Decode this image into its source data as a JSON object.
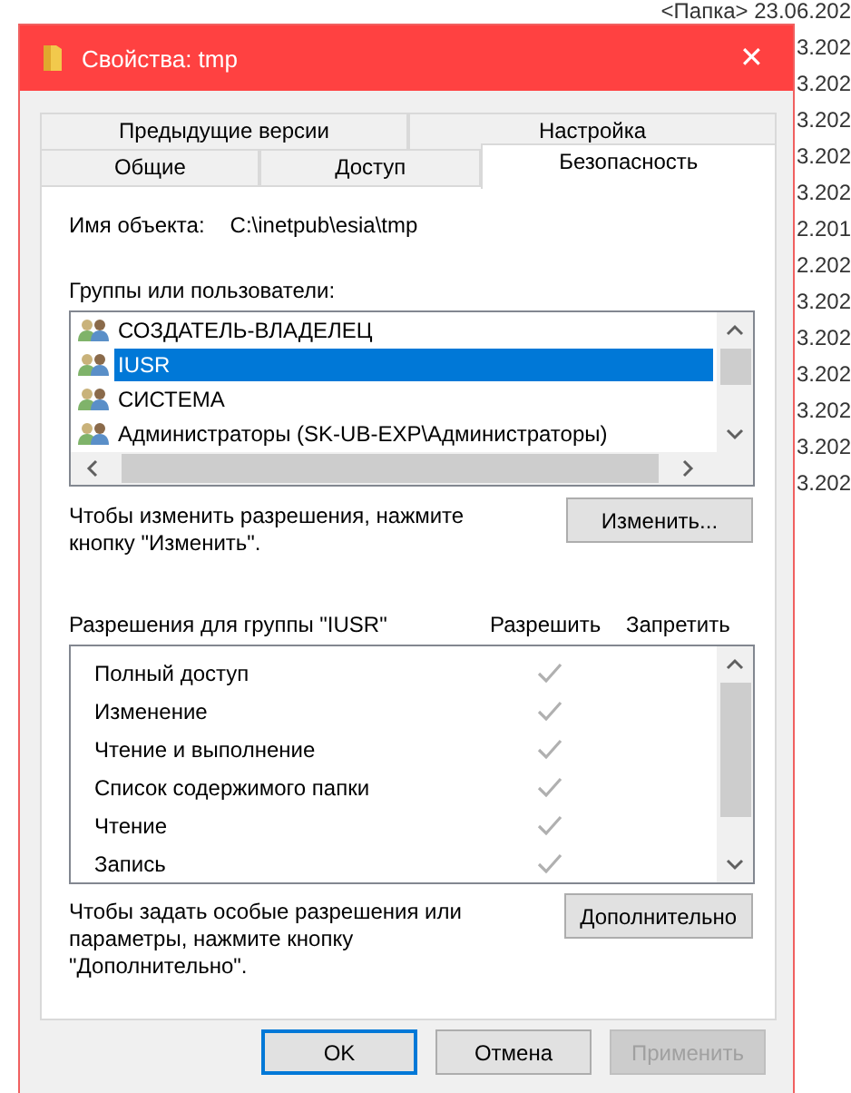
{
  "background_list": {
    "rows": [
      "<Папка>  23.06.202",
      "3.202",
      "3.202",
      "3.202",
      "3.202",
      "3.202",
      "2.201",
      "2.202",
      "3.202",
      "3.202",
      "3.202",
      "3.202",
      "3.202",
      "3.202"
    ]
  },
  "window": {
    "title": "Свойства: tmp",
    "close": "✕"
  },
  "tabs": [
    [
      {
        "label": "Предыдущие версии",
        "selected": false
      },
      {
        "label": "Настройка",
        "selected": false
      }
    ],
    [
      {
        "label": "Общие",
        "selected": false
      },
      {
        "label": "Доступ",
        "selected": false
      },
      {
        "label": "Безопасность",
        "selected": true
      }
    ]
  ],
  "object_name": {
    "label": "Имя объекта:",
    "value": "C:\\inetpub\\esia\\tmp"
  },
  "groups": {
    "label": "Группы или пользователи:",
    "items": [
      {
        "name": "СОЗДАТЕЛЬ-ВЛАДЕЛЕЦ",
        "selected": false
      },
      {
        "name": "IUSR",
        "selected": true
      },
      {
        "name": "СИСТЕМА",
        "selected": false
      },
      {
        "name": "Администраторы (SK-UB-EXP\\Администраторы)",
        "selected": false
      }
    ]
  },
  "change_hint": "Чтобы изменить разрешения, нажмите кнопку \"Изменить\".",
  "change_button": "Изменить...",
  "permissions": {
    "label": "Разрешения для группы \"IUSR\"",
    "allow_header": "Разрешить",
    "deny_header": "Запретить",
    "items": [
      {
        "name": "Полный доступ",
        "allow": true
      },
      {
        "name": "Изменение",
        "allow": true
      },
      {
        "name": "Чтение и выполнение",
        "allow": true
      },
      {
        "name": "Список содержимого папки",
        "allow": true
      },
      {
        "name": "Чтение",
        "allow": true
      },
      {
        "name": "Запись",
        "allow": true
      }
    ]
  },
  "advanced_hint": "Чтобы задать особые разрешения или параметры, нажмите кнопку \"Дополнительно\".",
  "advanced_button": "Дополнительно",
  "buttons": [
    {
      "label": "OK",
      "default": true,
      "disabled": false
    },
    {
      "label": "Отмена",
      "default": false,
      "disabled": false
    },
    {
      "label": "Применить",
      "default": false,
      "disabled": true
    }
  ]
}
